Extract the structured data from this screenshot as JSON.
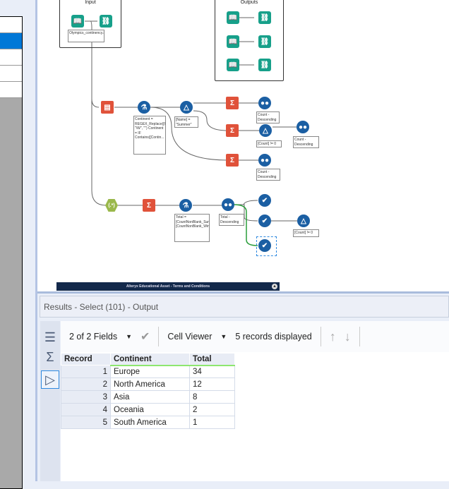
{
  "canvas": {
    "containers": {
      "input_title": "Input",
      "outputs_title": "Outputs"
    },
    "annotations": {
      "input": "Olympics_continency.xdb",
      "formula1": "Continent = REGEX_Replace([Continent], \"\\W\", \"\") Continent = IF Contains([Contin...",
      "filter1": "[Name] = \"Summer\"",
      "sort1": "Count - Descending",
      "filter2": "[Count] != 0",
      "sort3": "Count - Descending",
      "sort2": "Count - Descending",
      "formula2": "Total = [CountNonBlank_Summer]+ [CountNonBlank_Winter]",
      "sort4": "Total - Descending",
      "filter3": "[Count] != 0"
    },
    "banner": "Alteryx Educational Asset - Terms and Conditions"
  },
  "results": {
    "title": "Results - Select (101) - Output",
    "fields_label": "2 of 2 Fields",
    "viewer_label": "Cell Viewer",
    "records_label": "5 records displayed",
    "columns": [
      "Record",
      "Continent",
      "Total"
    ],
    "rows": [
      {
        "record": "1",
        "continent": "Europe",
        "total": "34"
      },
      {
        "record": "2",
        "continent": "North America",
        "total": "12"
      },
      {
        "record": "3",
        "continent": "Asia",
        "total": "8"
      },
      {
        "record": "4",
        "continent": "Oceania",
        "total": "2"
      },
      {
        "record": "5",
        "continent": "South America",
        "total": "1"
      }
    ]
  }
}
